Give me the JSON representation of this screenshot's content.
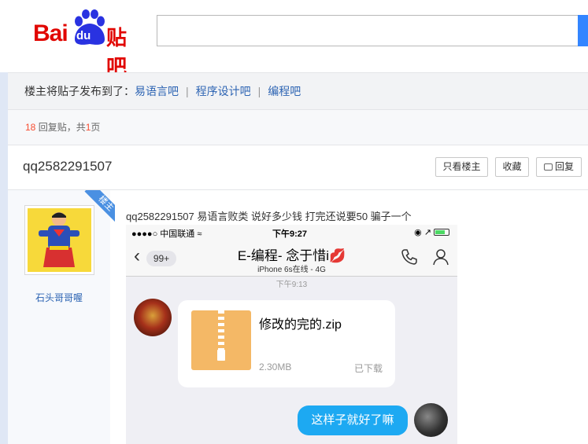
{
  "header": {
    "logo": {
      "bai": "Bai",
      "du": "du",
      "tieba": "贴吧"
    },
    "search": {
      "value": "",
      "placeholder": ""
    }
  },
  "forward": {
    "prefix": "楼主将贴子发布到了：",
    "forums": [
      "易语言吧",
      "程序设计吧",
      "编程吧"
    ],
    "separator": "|"
  },
  "reply_info": {
    "count": "18",
    "mid1": " 回复贴，共",
    "pages": "1",
    "mid2": "页"
  },
  "thread": {
    "title": "qq2582291507",
    "buttons": {
      "only_op": "只看楼主",
      "favorite": "收藏",
      "reply": "回复"
    }
  },
  "post": {
    "author": "石头哥哥喔",
    "badge": "楼主",
    "text": "qq2582291507 易语言败类 说好多少钱 打完还说要50 骗子一个"
  },
  "screenshot": {
    "status": {
      "left": "●●●●○ 中国联通 ≈",
      "time": "下午9:27",
      "right": "◉ ↗"
    },
    "nav": {
      "back_count": "99+",
      "title": "E-编程- 念于惜i💋",
      "subtitle": "iPhone 6s在线 - 4G"
    },
    "timestamp": "下午9:13",
    "file": {
      "name": "修改的完的.zip",
      "size": "2.30MB",
      "status": "已下载"
    },
    "my_message": "这样子就好了嘛"
  },
  "colors": {
    "brand_red": "#e10601",
    "link_blue": "#2d64b3",
    "search_blue": "#3385ff",
    "reply_red": "#f74c31",
    "bubble_blue": "#1da9f2"
  }
}
